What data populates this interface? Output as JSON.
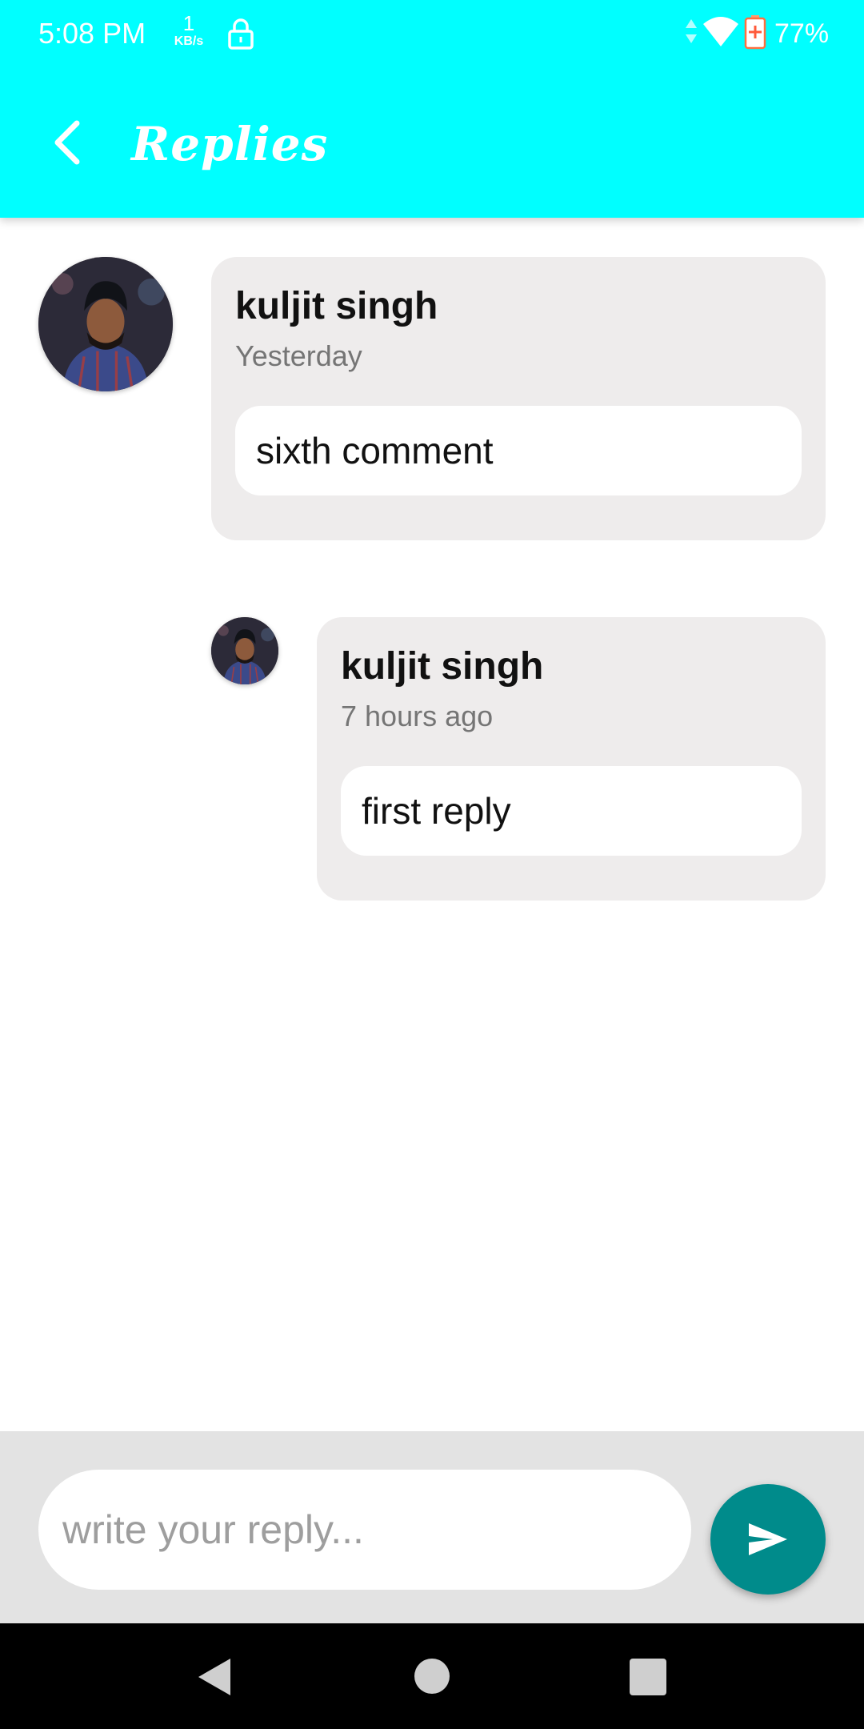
{
  "status_bar": {
    "time": "5:08 PM",
    "net_speed_value": "1",
    "net_speed_unit": "KB/s",
    "battery_percent": "77%"
  },
  "header": {
    "title": "Replies",
    "background_color": "#00ffff"
  },
  "comment": {
    "author": "kuljit singh",
    "time": "Yesterday",
    "text": "sixth comment"
  },
  "replies": [
    {
      "author": "kuljit singh",
      "time": "7 hours ago",
      "text": "first reply"
    }
  ],
  "composer": {
    "placeholder": "write your reply...",
    "value": "",
    "send_button_color": "#008b8b"
  },
  "icons": {
    "back": "back-arrow-icon",
    "send": "send-icon",
    "lock": "lock-icon",
    "wifi": "wifi-icon",
    "battery": "battery-charging-icon"
  }
}
